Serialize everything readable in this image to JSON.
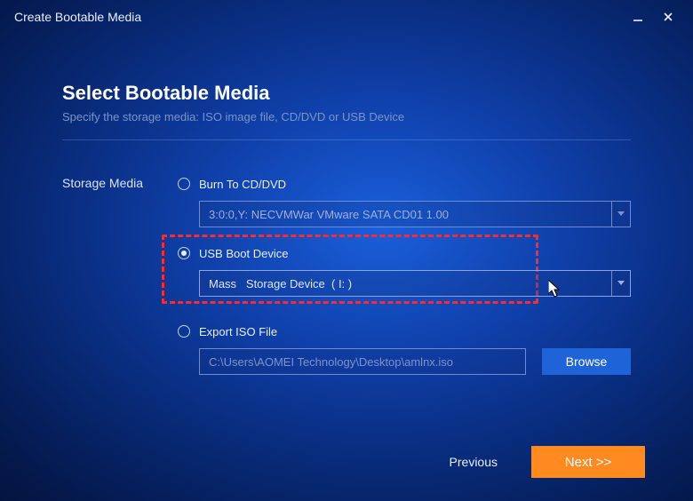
{
  "window": {
    "title": "Create Bootable Media"
  },
  "page": {
    "title": "Select Bootable Media",
    "subtitle": "Specify the storage media: ISO image file, CD/DVD or USB Device"
  },
  "labels": {
    "storage_media": "Storage Media"
  },
  "options": {
    "cd": {
      "label": "Burn To CD/DVD",
      "value": "3:0:0,Y: NECVMWar VMware SATA CD01 1.00"
    },
    "usb": {
      "label": "USB Boot Device",
      "value": "Mass   Storage Device  ( I: )"
    },
    "iso": {
      "label": "Export ISO File",
      "path": "C:\\Users\\AOMEI Technology\\Desktop\\amlnx.iso",
      "browse": "Browse"
    }
  },
  "footer": {
    "previous": "Previous",
    "next": "Next >>"
  }
}
